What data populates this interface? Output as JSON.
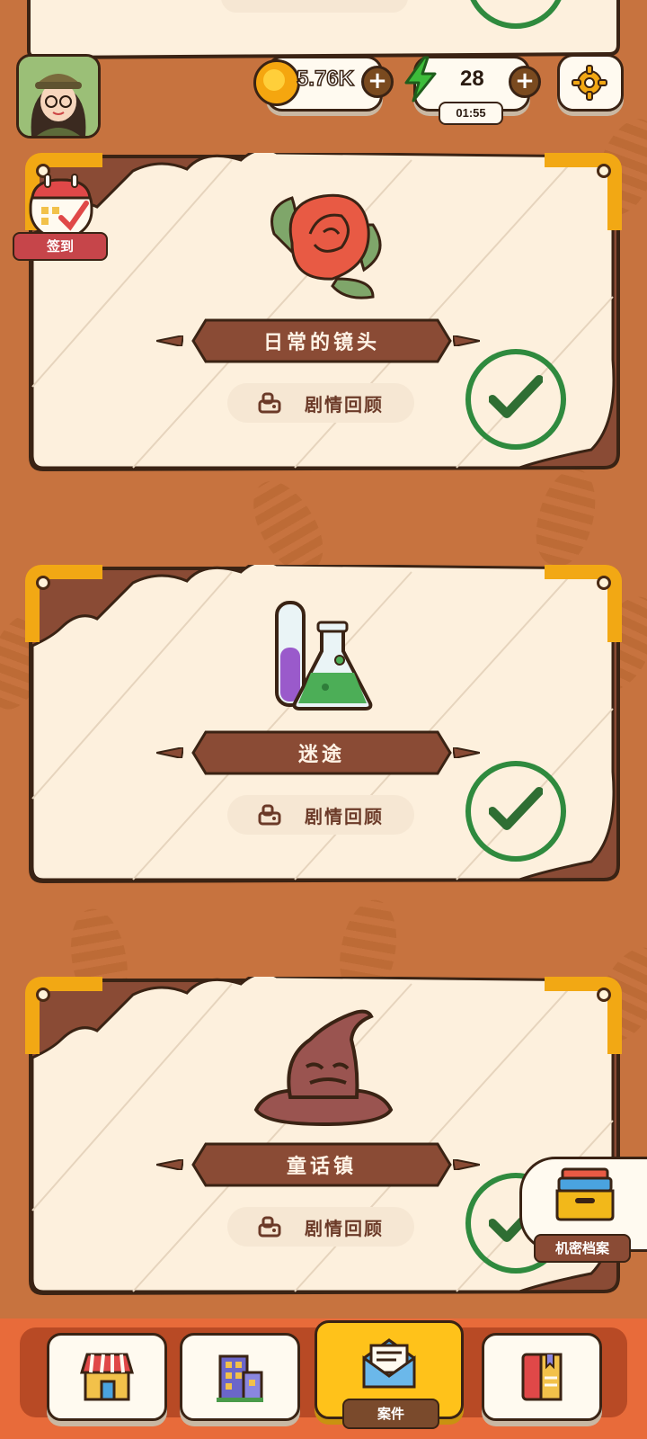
{
  "player": {
    "avatar": "girl-detective-avatar"
  },
  "currency": {
    "coins": "5.76K",
    "energy": "28",
    "energy_timer": "01:55"
  },
  "icons": {
    "coin": "coin-icon",
    "energy": "lightning-icon",
    "settings": "gear-icon"
  },
  "checkin": {
    "label": "签到"
  },
  "cases": [
    {
      "title": "日常的镜头",
      "item_icon": "rose-icon",
      "review_label": "剧情回顾",
      "completed": true
    },
    {
      "title": "迷途",
      "item_icon": "lab-flasks-icon",
      "review_label": "剧情回顾",
      "completed": true
    },
    {
      "title": "童话镇",
      "item_icon": "wizard-hat-icon",
      "review_label": "剧情回顾",
      "completed": true
    }
  ],
  "archive": {
    "label": "机密档案"
  },
  "nav": {
    "items": [
      {
        "name": "shop",
        "icon": "shop-icon"
      },
      {
        "name": "city",
        "icon": "building-icon"
      },
      {
        "name": "cases",
        "icon": "mail-icon",
        "label": "案件",
        "active": true
      },
      {
        "name": "book",
        "icon": "book-icon"
      }
    ]
  },
  "colors": {
    "background": "#c7733f",
    "card": "#fdf0dd",
    "banner": "#8a4b35",
    "check": "#2f8a3e",
    "accent": "#ffc21a"
  }
}
